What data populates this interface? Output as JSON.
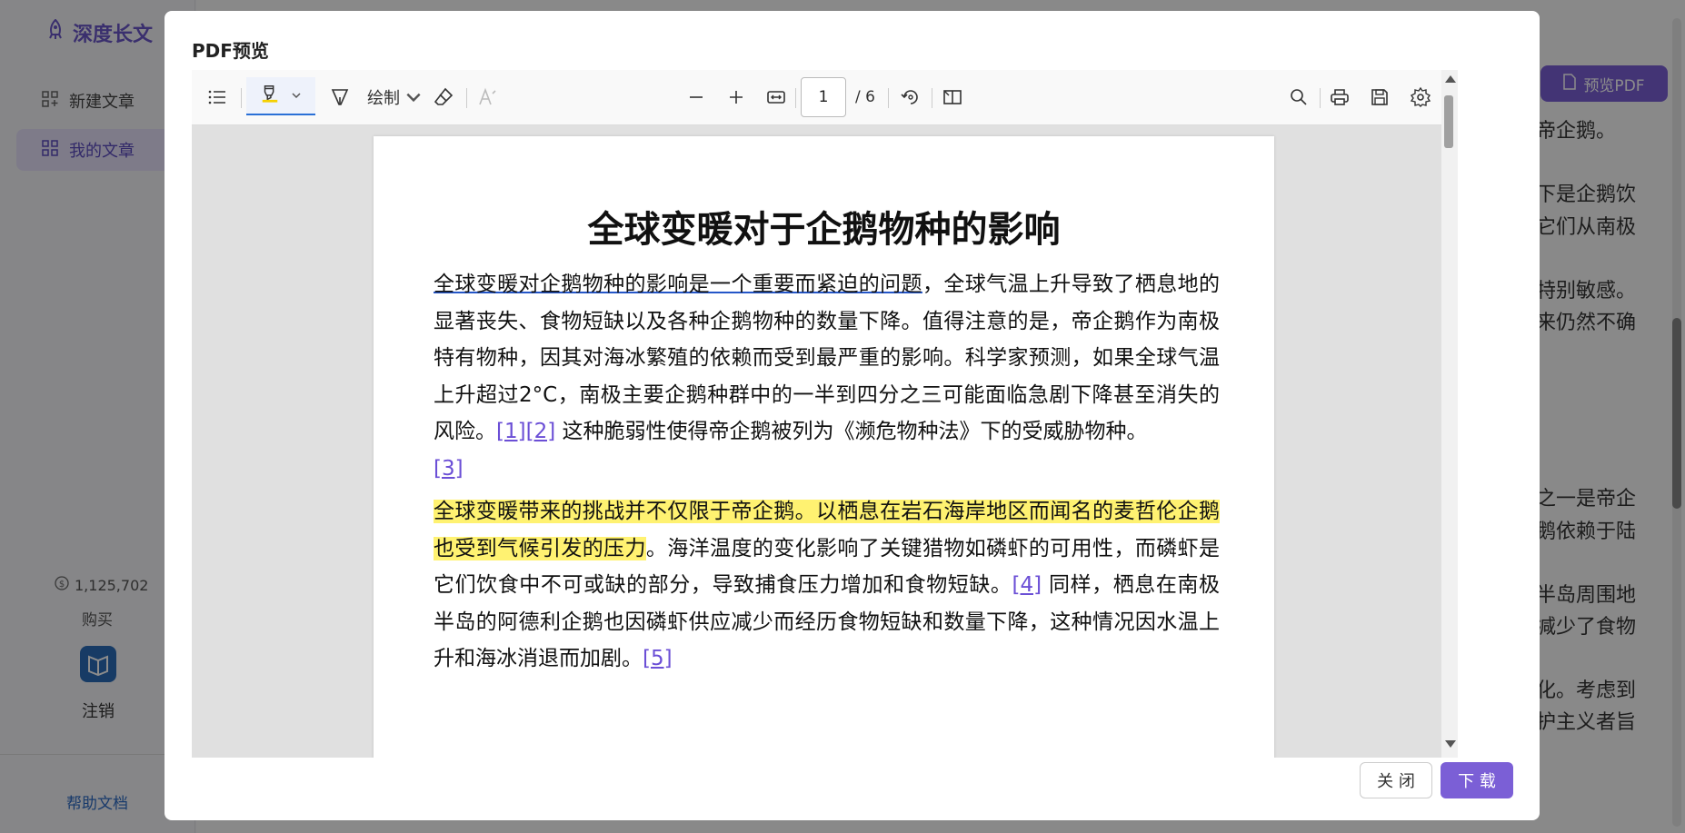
{
  "app": {
    "brand": "深度长文",
    "nav": [
      {
        "label": "新建文章"
      },
      {
        "label": "我的文章"
      }
    ],
    "credits": "1,125,702",
    "buy": "购买",
    "logout": "注销",
    "help": "帮助文档",
    "preview_pdf": "预览PDF",
    "bg_lines": [
      "帝企鹅。",
      "下是企鹅饮",
      "它们从南极",
      "特别敏感。",
      "来仍然不确",
      "之一是帝企",
      "鹅依赖于陆",
      "半岛周围地",
      "减少了食物",
      "化。考虑到",
      "护主义者旨"
    ]
  },
  "modal": {
    "title": "PDF预览",
    "toolbar": {
      "draw_label": "绘制",
      "page_current": "1",
      "page_total": "/ 6"
    },
    "document": {
      "title": "全球变暖对于企鹅物种的影响",
      "p1_underlined": "全球变暖对企鹅物种的影响是一个重要而紧迫的问题",
      "p1_rest": "，全球气温上升导致了栖息地的显著丧失、食物短缺以及各种企鹅物种的数量下降。值得注意的是，帝企鹅作为南极特有物种，因其对海冰繁殖的依赖而受到最严重的影响。科学家预测，如果全球气温上升超过2°C，南极主要企鹅种群中的一半到四分之三可能面临急剧下降甚至消失的风险。",
      "ref1": "[1]",
      "ref2": "[2]",
      "p1_tail": " 这种脆弱性使得帝企鹅被列为《濒危物种法》下的受威胁物种。",
      "ref3": "[3]",
      "p2_highlight": "全球变暖带来的挑战并不仅限于帝企鹅。以栖息在岩石海岸地区而闻名的麦哲伦企鹅也受到气候引发的压力",
      "p2_rest": "。海洋温度的变化影响了关键猎物如磷虾的可用性，而磷虾是它们饮食中不可或缺的部分，导致捕食压力增加和食物短缺。",
      "ref4": "[4]",
      "p2_tail": " 同样，栖息在南极半岛的阿德利企鹅也因磷虾供应减少而经历食物短缺和数量下降，这种情况因水温上升和海冰消退而加剧。",
      "ref5": "[5]"
    },
    "close_label": "关 闭",
    "download_label": "下 载"
  }
}
